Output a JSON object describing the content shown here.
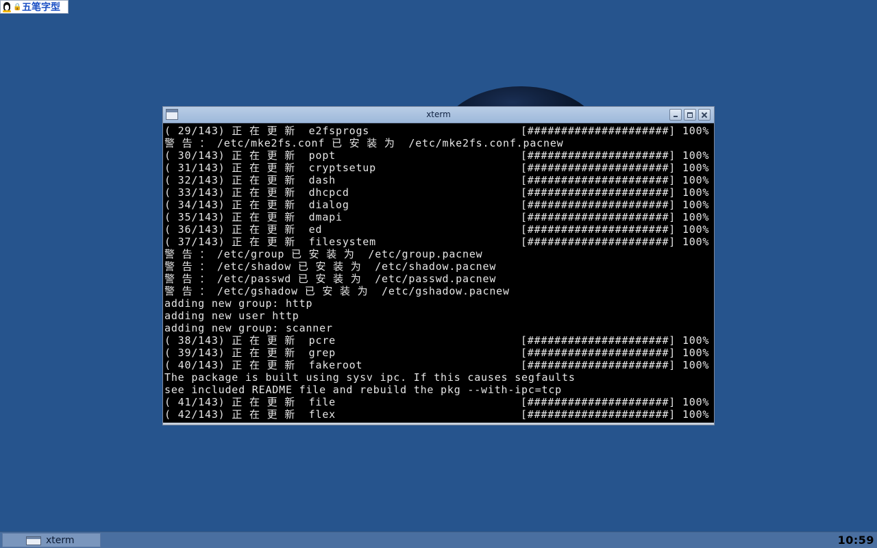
{
  "ime": {
    "name": "五笔字型",
    "lock_glyph": "🔒"
  },
  "window": {
    "title": "xterm"
  },
  "terminal": {
    "lines": [
      {
        "left": "( 29/143) 正 在 更 新  e2fsprogs",
        "right": "[#####################] 100%"
      },
      {
        "left": "警 告 ： /etc/mke2fs.conf 已 安 装 为  /etc/mke2fs.conf.pacnew",
        "right": ""
      },
      {
        "left": "( 30/143) 正 在 更 新  popt",
        "right": "[#####################] 100%"
      },
      {
        "left": "( 31/143) 正 在 更 新  cryptsetup",
        "right": "[#####################] 100%"
      },
      {
        "left": "( 32/143) 正 在 更 新  dash",
        "right": "[#####################] 100%"
      },
      {
        "left": "( 33/143) 正 在 更 新  dhcpcd",
        "right": "[#####################] 100%"
      },
      {
        "left": "( 34/143) 正 在 更 新  dialog",
        "right": "[#####################] 100%"
      },
      {
        "left": "( 35/143) 正 在 更 新  dmapi",
        "right": "[#####################] 100%"
      },
      {
        "left": "( 36/143) 正 在 更 新  ed",
        "right": "[#####################] 100%"
      },
      {
        "left": "( 37/143) 正 在 更 新  filesystem",
        "right": "[#####################] 100%"
      },
      {
        "left": "警 告 ： /etc/group 已 安 装 为  /etc/group.pacnew",
        "right": ""
      },
      {
        "left": "警 告 ： /etc/shadow 已 安 装 为  /etc/shadow.pacnew",
        "right": ""
      },
      {
        "left": "警 告 ： /etc/passwd 已 安 装 为  /etc/passwd.pacnew",
        "right": ""
      },
      {
        "left": "警 告 ： /etc/gshadow 已 安 装 为  /etc/gshadow.pacnew",
        "right": ""
      },
      {
        "left": "adding new group: http",
        "right": ""
      },
      {
        "left": "adding new user http",
        "right": ""
      },
      {
        "left": "adding new group: scanner",
        "right": ""
      },
      {
        "left": "( 38/143) 正 在 更 新  pcre",
        "right": "[#####################] 100%"
      },
      {
        "left": "( 39/143) 正 在 更 新  grep",
        "right": "[#####################] 100%"
      },
      {
        "left": "( 40/143) 正 在 更 新  fakeroot",
        "right": "[#####################] 100%"
      },
      {
        "left": "The package is built using sysv ipc. If this causes segfaults",
        "right": ""
      },
      {
        "left": "see included README file and rebuild the pkg --with-ipc=tcp",
        "right": ""
      },
      {
        "left": "( 41/143) 正 在 更 新  file",
        "right": "[#####################] 100%"
      },
      {
        "left": "( 42/143) 正 在 更 新  flex",
        "right": "[#####################] 100%"
      }
    ]
  },
  "taskbar": {
    "tasks": [
      {
        "label": "xterm",
        "icon": "window-icon"
      }
    ],
    "clock": "10:59"
  },
  "colors": {
    "desktop_bg": "#26548d",
    "terminal_bg": "#000000",
    "terminal_fg": "#e6e6e6",
    "titlebar": "#b9cde6",
    "taskbar": "#4a6fa0"
  }
}
